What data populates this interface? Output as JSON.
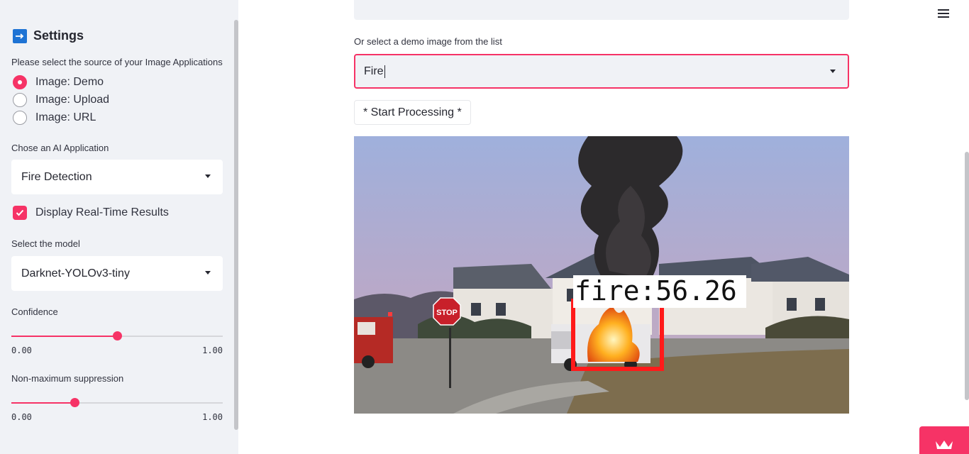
{
  "sidebar": {
    "title": "Settings",
    "title_icon": "right-arrow-icon",
    "source_label": "Please select the source of your Image Applications",
    "source_options": [
      "Image: Demo",
      "Image: Upload",
      "Image: URL"
    ],
    "source_selected": "Image: Demo",
    "app_label": "Chose an AI Application",
    "app_value": "Fire Detection",
    "realtime_label": "Display Real-Time Results",
    "realtime_checked": true,
    "model_label": "Select the model",
    "model_value": "Darknet-YOLOv3-tiny",
    "confidence": {
      "label": "Confidence",
      "min": "0.00",
      "max": "1.00",
      "value": 0.5
    },
    "nms": {
      "label": "Non-maximum suppression",
      "min": "0.00",
      "max": "1.00",
      "value": 0.3
    }
  },
  "main": {
    "demo_label": "Or select a demo image from the list",
    "demo_value": "Fire",
    "start_button": "* Start Processing *",
    "detection": {
      "label": "fire:56.26"
    },
    "sign_text": "STOP"
  },
  "menu_icon": "hamburger-menu-icon",
  "badge_icon": "streamlit-crown-icon",
  "colors": {
    "accent": "#f63366",
    "sidebar_bg": "#f0f2f6",
    "settings_icon": "#1e73d4",
    "detection_box": "#ff1a1a"
  }
}
